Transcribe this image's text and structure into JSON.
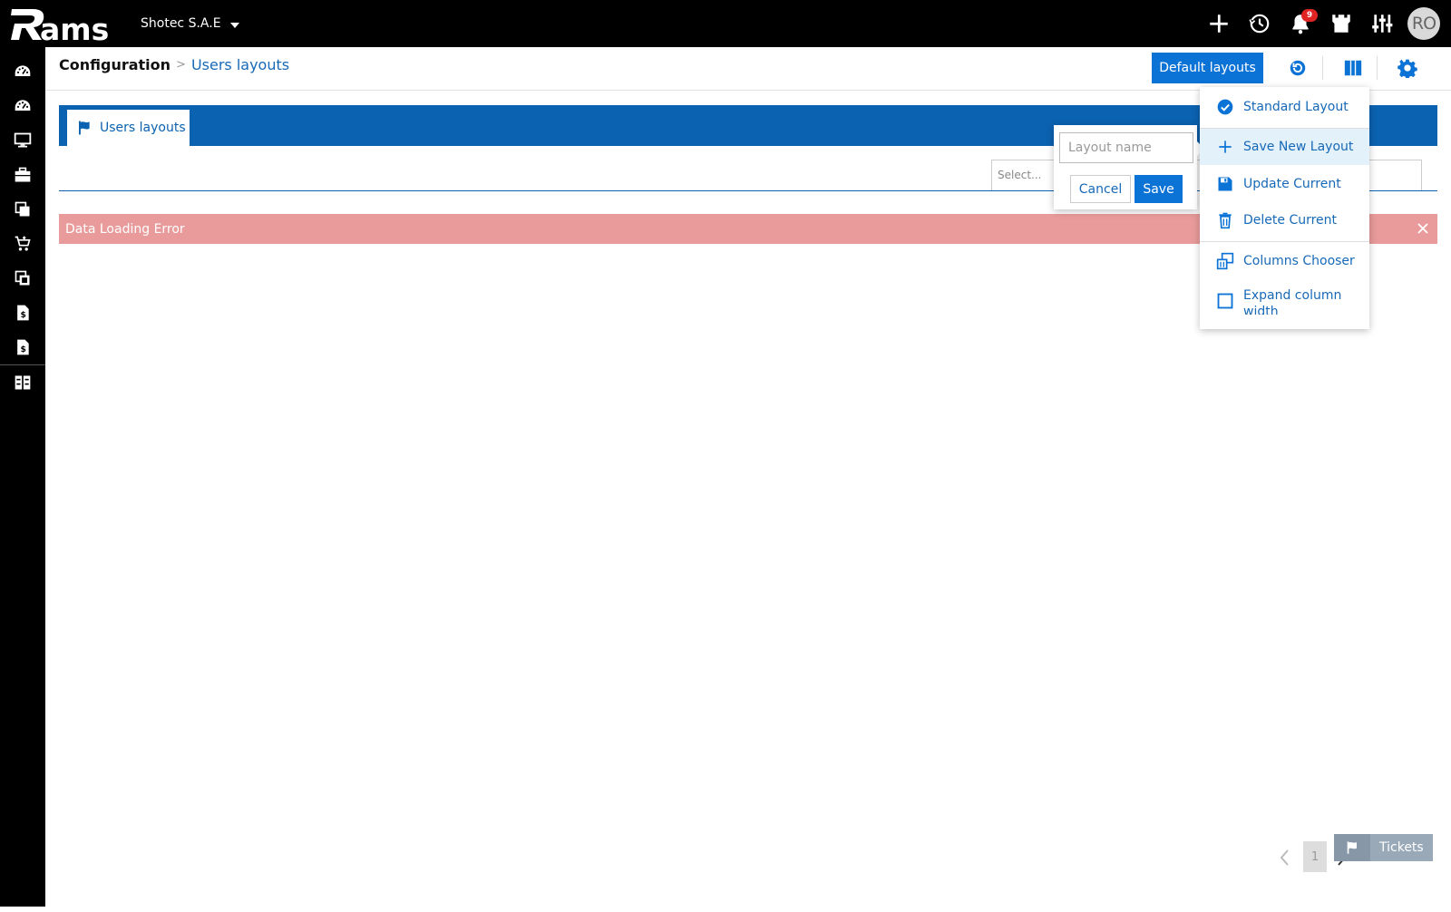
{
  "topbar": {
    "company": "Shotec S.A.E",
    "notification_count": "9",
    "avatar_initials": "RO"
  },
  "header": {
    "breadcrumb_root": "Configuration",
    "breadcrumb_sep": ">",
    "breadcrumb_current": "Users layouts",
    "default_layouts_label": "Default layouts"
  },
  "tabs": {
    "users_layouts": "Users layouts"
  },
  "filter": {
    "select_placeholder": "Select..."
  },
  "error": {
    "message": "Data Loading Error"
  },
  "save_popover": {
    "input_placeholder": "Layout name",
    "cancel_label": "Cancel",
    "save_label": "Save"
  },
  "layout_menu": {
    "items": [
      {
        "label": "Standard Layout",
        "icon": "check-circle-icon"
      },
      {
        "label": "Save New Layout",
        "icon": "plus-icon"
      },
      {
        "label": "Update Current",
        "icon": "floppy-disk-icon"
      },
      {
        "label": "Delete Current",
        "icon": "trash-icon"
      },
      {
        "label": "Columns Chooser",
        "icon": "columns-chooser-icon"
      },
      {
        "label": "Expand column width",
        "icon": "checkbox-icon"
      }
    ]
  },
  "pager": {
    "current_page": "1"
  },
  "tickets": {
    "label": "Tickets"
  },
  "colors": {
    "primary": "#0b72d6",
    "tab_bar": "#0b62b0",
    "error_bg": "#e99b9b",
    "menu_active": "#e3f1fb",
    "badge": "#e02424"
  }
}
